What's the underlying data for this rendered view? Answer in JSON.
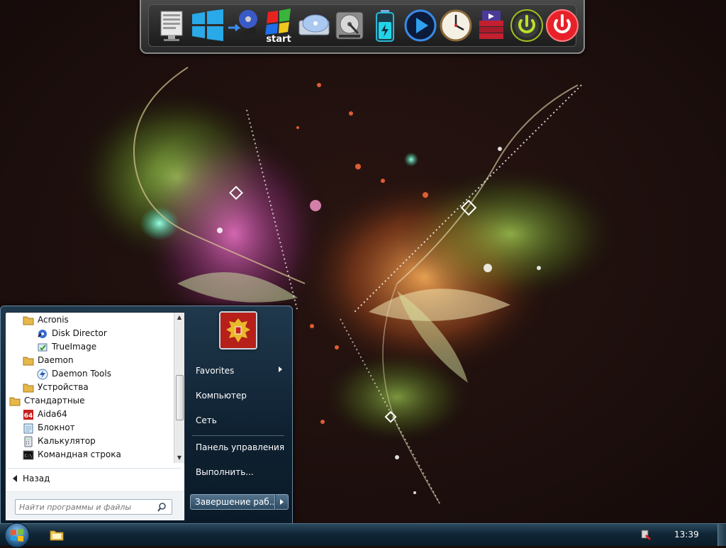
{
  "dock": {
    "icons": [
      "computer-icon",
      "windows-logo-icon",
      "usb-install-icon",
      "start-icon",
      "optical-disc-icon",
      "hard-drive-icon",
      "battery-icon",
      "media-player-icon",
      "clock-icon",
      "archive-icon",
      "standby-icon",
      "power-off-icon"
    ],
    "start_icon_text": "start"
  },
  "start_menu": {
    "programs": [
      {
        "label": "Acronis",
        "icon": "folder-icon",
        "indent": 1
      },
      {
        "label": "Disk Director",
        "icon": "disk-director-icon",
        "indent": 2
      },
      {
        "label": "TrueImage",
        "icon": "trueimage-icon",
        "indent": 2
      },
      {
        "label": "Daemon",
        "icon": "folder-icon",
        "indent": 1
      },
      {
        "label": "Daemon Tools",
        "icon": "daemon-tools-icon",
        "indent": 2
      },
      {
        "label": "Устройства",
        "icon": "folder-icon",
        "indent": 1
      },
      {
        "label": "Стандартные",
        "icon": "folder-icon",
        "indent": 0
      },
      {
        "label": "Aida64",
        "icon": "aida64-icon",
        "indent": 1
      },
      {
        "label": "Блокнот",
        "icon": "notepad-icon",
        "indent": 1
      },
      {
        "label": "Калькулятор",
        "icon": "calculator-icon",
        "indent": 1
      },
      {
        "label": "Командная строка",
        "icon": "cmd-icon",
        "indent": 1
      }
    ],
    "aida_icon_text": "64",
    "cmd_icon_text": "C:\\",
    "back_label": "Назад",
    "search_placeholder": "Найти программы и файлы",
    "right_items": {
      "favorites": "Favorites",
      "computer": "Компьютер",
      "network": "Сеть",
      "control_panel": "Панель управления",
      "run": "Выполнить..."
    },
    "shutdown_label": "Завершение раб..."
  },
  "taskbar": {
    "clock": "13:39"
  },
  "colors": {
    "menu_bg": "#0e2030",
    "taskbar_bg": "#102636",
    "avatar_red": "#b61f1a",
    "avatar_gold": "#e8b92c"
  }
}
